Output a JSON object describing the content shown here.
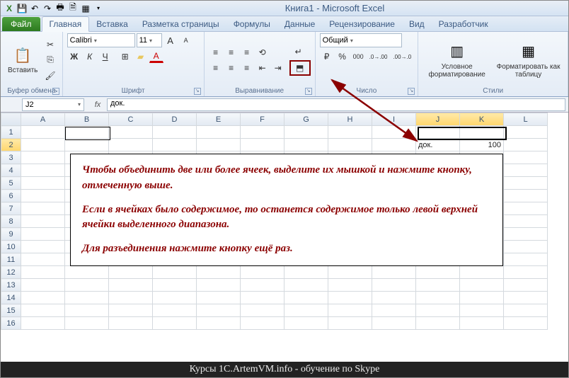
{
  "title": "Книга1 - Microsoft Excel",
  "qat": {
    "app_icon": "X",
    "save": "💾",
    "undo": "↶",
    "redo": "↷",
    "print": "🖶",
    "preview": "🗎",
    "table": "▦"
  },
  "tabs": {
    "file": "Файл",
    "items": [
      "Главная",
      "Вставка",
      "Разметка страницы",
      "Формулы",
      "Данные",
      "Рецензирование",
      "Вид",
      "Разработчик"
    ],
    "active_index": 0
  },
  "ribbon": {
    "clipboard": {
      "label": "Буфер обмена",
      "paste": "Вставить",
      "cut": "✂",
      "copy": "⎘",
      "fmt": "🖌"
    },
    "font": {
      "label": "Шрифт",
      "name": "Calibri",
      "size": "11",
      "bold": "Ж",
      "italic": "К",
      "underline": "Ч",
      "increase": "A",
      "decrease": "A",
      "border": "⊞",
      "fill": "▰",
      "color": "A"
    },
    "align": {
      "label": "Выравнивание",
      "top": "≡",
      "mid": "≡",
      "bot": "≡",
      "left": "≡",
      "center": "≡",
      "right": "≡",
      "wrap": "↵",
      "merge": "⬒",
      "indentL": "⇤",
      "indentR": "⇥",
      "orient": "⟲"
    },
    "number": {
      "label": "Число",
      "format": "Общий",
      "currency": "₽",
      "percent": "%",
      "comma": "000",
      "inc": ".00→.0",
      "dec": ".0→.00"
    },
    "styles": {
      "label": "Стили",
      "cond": "Условное форматирование",
      "fmt_table": "Форматировать как таблицу"
    }
  },
  "namebox": "J2",
  "formula": "док.",
  "columns": [
    "A",
    "B",
    "C",
    "D",
    "E",
    "F",
    "G",
    "H",
    "I",
    "J",
    "K",
    "L"
  ],
  "rows_count": 16,
  "sel_cols": [
    "J",
    "K"
  ],
  "sel_row": 2,
  "cell_J2": "док.",
  "cell_K2": "100",
  "annotation": {
    "p1": "Чтобы объединить две или более ячеек, выделите их мышкой и нажмите кнопку, отмеченную выше.",
    "p2": "Если в ячейках было содержимое, то останется содержимое только левой верхней ячейки выделенного диапазона.",
    "p3": "Для разъединения нажмите кнопку ещё раз."
  },
  "footer": "Курсы 1C.ArtemVM.info - обучение по Skype"
}
